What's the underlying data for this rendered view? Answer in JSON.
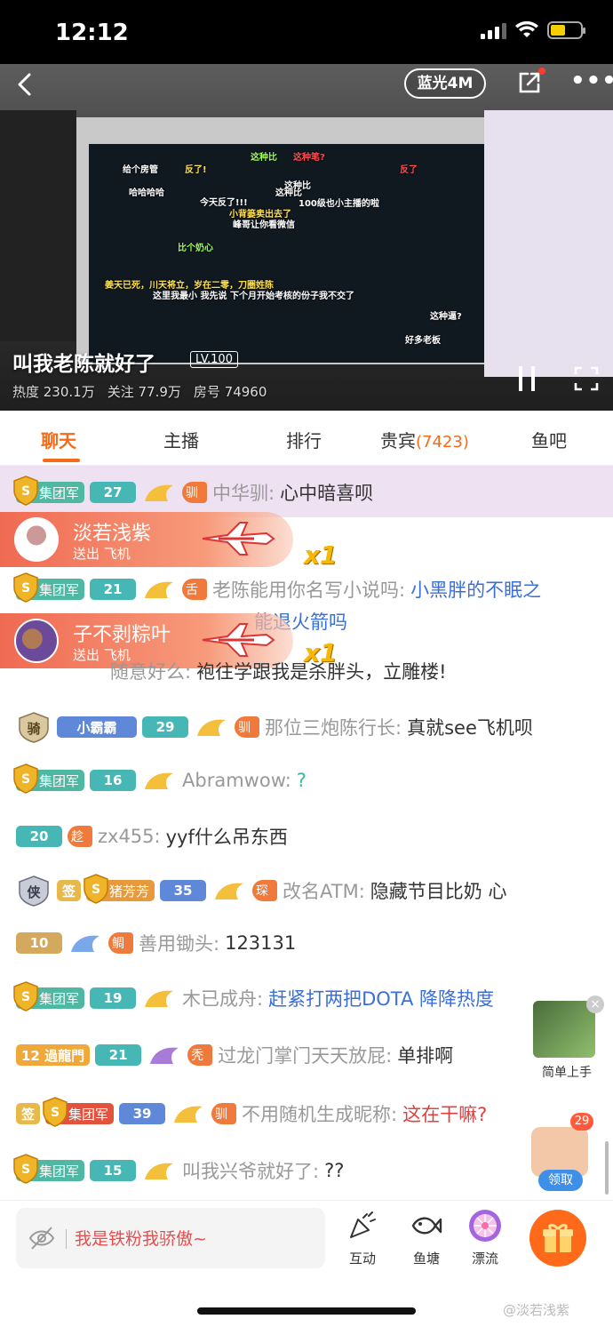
{
  "status": {
    "time": "12:12"
  },
  "video": {
    "quality_label": "蓝光4M",
    "title": "叫我老陈就好了",
    "level": "LV.100",
    "heat": "热度 230.1万",
    "follow": "关注 77.9万",
    "room": "房号 74960",
    "danmu": [
      "这种比",
      "这种笔?",
      "给个房管",
      "反了!",
      "反了",
      "哈哈哈哈",
      "这种比",
      "今天反了!!!",
      "100级也小主播的啦",
      "小背篓卖出去了",
      "峰哥让你看微信",
      "这种比",
      "比个奶心",
      "这里我最小 我先说 下个月开始考核的份子我不交了",
      "姜天已死，川天将立，岁在二零，刀圈姓陈",
      "这种逼?",
      "好多老板"
    ]
  },
  "tabs": {
    "chat": "聊天",
    "anchor": "主播",
    "rank": "排行",
    "guest": "贵宾",
    "guest_count": "(7423)",
    "fishbar": "鱼吧"
  },
  "chat": {
    "messages": [
      {
        "group": "集团军",
        "lv": "27",
        "fan": "驯",
        "nick": "中华驯:",
        "text": "心中暗喜呗"
      },
      {
        "group": "集团军",
        "lv": "21",
        "fan": "舌",
        "nick": "老陈能用你名写小说吗:",
        "text": "小黑胖的不眠之",
        "text2": "能退火箭吗"
      },
      {
        "nick": "随意好么:",
        "text": "袍往学跟我是杀胖头，立雕楼!"
      },
      {
        "noble": "骑",
        "fan_user": "小霸霸",
        "lv": "29",
        "fan": "驯",
        "nick": "那位三炮陈行长:",
        "text": "真就see飞机呗"
      },
      {
        "group": "集团军",
        "lv": "16",
        "nick": "Abramwow:",
        "text": "?"
      },
      {
        "lv": "20",
        "fan": "趁",
        "nick": "zx455:",
        "text": "yyf什么吊东西"
      },
      {
        "noble": "侠",
        "sign": "签",
        "fan_user": "猪芳芳",
        "lv": "35",
        "fan": "琛",
        "nick": "改名ATM:",
        "text": "隐藏节目比奶 心"
      },
      {
        "lv": "10",
        "fan": "鲷",
        "nick": "善用锄头:",
        "text": "123131"
      },
      {
        "group": "集团军",
        "lv": "19",
        "nick": "木已成舟:",
        "text": "赶紧打两把DOTA 降降热度"
      },
      {
        "lv_prefix": "12 過龍門",
        "lv": "21",
        "fan": "秃",
        "nick": "过龙门掌门天天放屁:",
        "text": "单排啊"
      },
      {
        "sign": "签",
        "group": "集团军",
        "lv": "39",
        "fan": "驯",
        "nick": "不用随机生成昵称:",
        "text": "这在干嘛?"
      },
      {
        "group": "集团军",
        "lv": "15",
        "nick": "叫我兴爷就好了:",
        "text": "??"
      }
    ],
    "gifts": [
      {
        "name": "淡若浅紫",
        "sub": "送出 飞机",
        "count": "x1"
      },
      {
        "name": "子不剥粽叶",
        "sub": "送出 飞机",
        "count": "x1"
      }
    ]
  },
  "promo": {
    "label": "简单上手"
  },
  "red_pack": {
    "count": "29",
    "label": "领取"
  },
  "bottom": {
    "input_placeholder": "我是铁粉我骄傲~",
    "btn_interact": "互动",
    "btn_fishpond": "鱼塘",
    "btn_drift": "漂流"
  },
  "watermark": "@淡若浅紫",
  "colors": {
    "accent": "#f66b19",
    "group_badge": "#4fb8a3",
    "gift_banner": "#f06a52"
  }
}
